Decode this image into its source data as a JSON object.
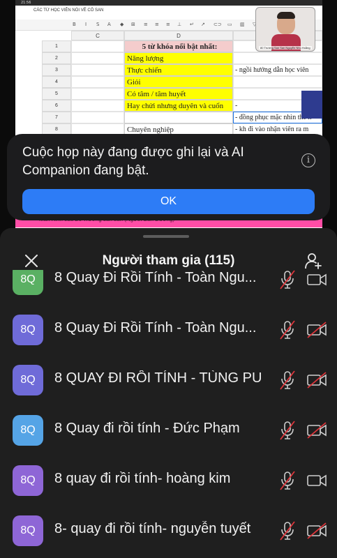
{
  "shared_screen": {
    "status_time": "21:56",
    "doc_title": "CÁC TỪ HỌC VIÊN NÓI VỀ CÔ SAN",
    "columns": [
      "C",
      "D",
      "E"
    ],
    "rows": [
      {
        "num": "1",
        "d": "5 từ khóa nổi bật nhất:",
        "e": "",
        "style": "pink"
      },
      {
        "num": "2",
        "d": "Năng lượng",
        "e": "",
        "style": "yellow"
      },
      {
        "num": "3",
        "d": "Thực chiến",
        "e": "- ngồi hướng dẫn học viên",
        "style": "yellow"
      },
      {
        "num": "4",
        "d": "Giỏi",
        "e": "",
        "style": "yellow"
      },
      {
        "num": "5",
        "d": "Có tâm / tâm huyết",
        "e": "",
        "style": "yellow"
      },
      {
        "num": "6",
        "d": "Hay chửi nhưng duyên và cuốn",
        "e": "-",
        "style": "yellow"
      },
      {
        "num": "7",
        "d": "",
        "e": "- đồng phục mặc nhìn thế n",
        "style": "plain"
      },
      {
        "num": "8",
        "d": "Chuyên nghiệp",
        "e": "- kh đi vào nhận viên ra m",
        "style": "plain"
      }
    ],
    "bottom_strip": "Mân Kinh của Bồ Trường sản sản (Người Bán Đường)"
  },
  "video_thumbnail": {
    "name": "80 Trường San San Nguyễn Nhu Hoằng"
  },
  "recording_dialog": {
    "message": "Cuộc họp này đang được ghi lại và AI Companion đang bật.",
    "ok_label": "OK",
    "info_icon": "info-icon"
  },
  "participants_panel": {
    "title": "Người tham gia (115)",
    "close_icon": "close-icon",
    "add_icon": "add-participant-icon",
    "participants": [
      {
        "initials": "8Q",
        "name": "8 Quay Đi Rồi Tính - Toàn Ngu...",
        "color": "#5ab063",
        "mic_muted": true,
        "video_off": false
      },
      {
        "initials": "8Q",
        "name": "8 Quay Đi Rồi Tính - Toàn Ngu...",
        "color": "#6f6bd8",
        "mic_muted": true,
        "video_off": true
      },
      {
        "initials": "8Q",
        "name": "8 QUAY ĐI RỒI TÍNH - TÙNG PU",
        "color": "#6f6bd8",
        "mic_muted": true,
        "video_off": true
      },
      {
        "initials": "8Q",
        "name": "8 Quay đi rồi tính - Đức Phạm",
        "color": "#55a4e6",
        "mic_muted": true,
        "video_off": true
      },
      {
        "initials": "8Q",
        "name": "8 quay đi rồi tính- hoàng kim",
        "color": "#8e66d6",
        "mic_muted": true,
        "video_off": false
      },
      {
        "initials": "8Q",
        "name": "8- quay đi rồi tính- nguyễn tuyết",
        "color": "#8e66d6",
        "mic_muted": true,
        "video_off": true
      }
    ]
  }
}
